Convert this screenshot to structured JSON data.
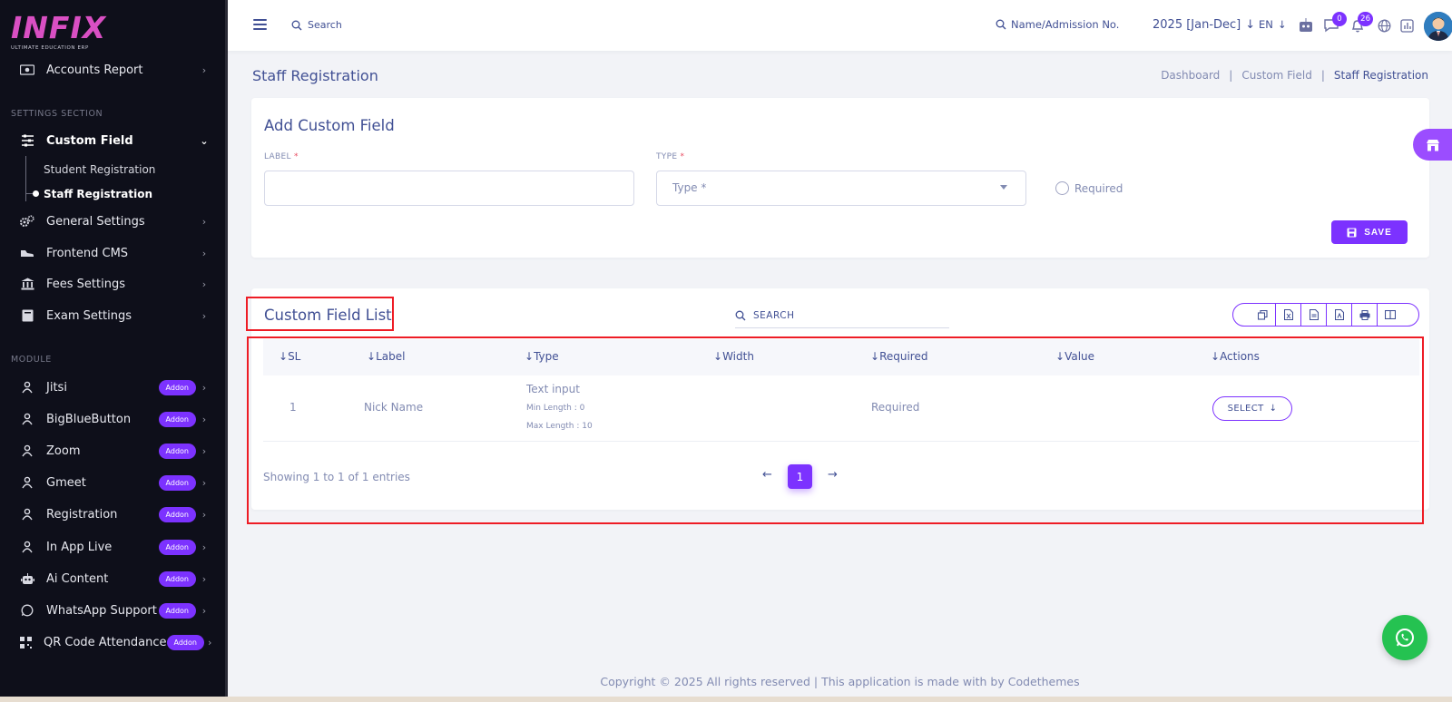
{
  "brand": {
    "logo": "INFIX",
    "tagline": "ULTIMATE EDUCATION ERP"
  },
  "sidebar": {
    "accounts_report": "Accounts Report",
    "settings_section": "SETTINGS SECTION",
    "custom_field": "Custom Field",
    "sub_items": [
      "Student Registration",
      "Staff Registration"
    ],
    "general_settings": "General Settings",
    "frontend_cms": "Frontend CMS",
    "fees_settings": "Fees Settings",
    "exam_settings": "Exam Settings",
    "module_section": "MODULE",
    "addon_label": "Addon",
    "modules": [
      "Jitsi",
      "BigBlueButton",
      "Zoom",
      "Gmeet",
      "Registration",
      "In App Live",
      "Ai Content",
      "WhatsApp Support",
      "QR Code Attendance"
    ]
  },
  "topbar": {
    "search_label": "Search",
    "name_search": "Name/Admission No.",
    "session": "2025 [Jan-Dec]",
    "language": "EN",
    "chat_count": "0",
    "notification_count": "26"
  },
  "page": {
    "title": "Staff Registration",
    "breadcrumb": [
      "Dashboard",
      "Custom Field",
      "Staff Registration"
    ],
    "separator": "|"
  },
  "form": {
    "title": "Add Custom Field",
    "label_field": "LABEL",
    "type_field": "TYPE",
    "required_mark": "*",
    "type_placeholder": "Type *",
    "required_label": "Required",
    "save_label": "SAVE"
  },
  "list": {
    "title": "Custom Field List",
    "search_label": "SEARCH",
    "columns": [
      "SL",
      "Label",
      "Type",
      "Width",
      "Required",
      "Value",
      "Actions"
    ],
    "rows": [
      {
        "sl": "1",
        "label": "Nick Name",
        "type": "Text input",
        "min": "Min Length : 0",
        "max": "Max Length : 10",
        "width": "",
        "required": "Required",
        "value": "",
        "action": "SELECT"
      }
    ],
    "showing": "Showing 1 to 1 of 1 entries",
    "current_page": "1"
  },
  "footer": "Copyright © 2025 All rights reserved | This application is made with by Codethemes",
  "colors": {
    "accent": "#7c32ff",
    "sidebar_bg": "#0e0f1a",
    "text": "#415094",
    "muted": "#828bb2",
    "highlight": "#ee1c25",
    "whatsapp": "#25c251"
  }
}
